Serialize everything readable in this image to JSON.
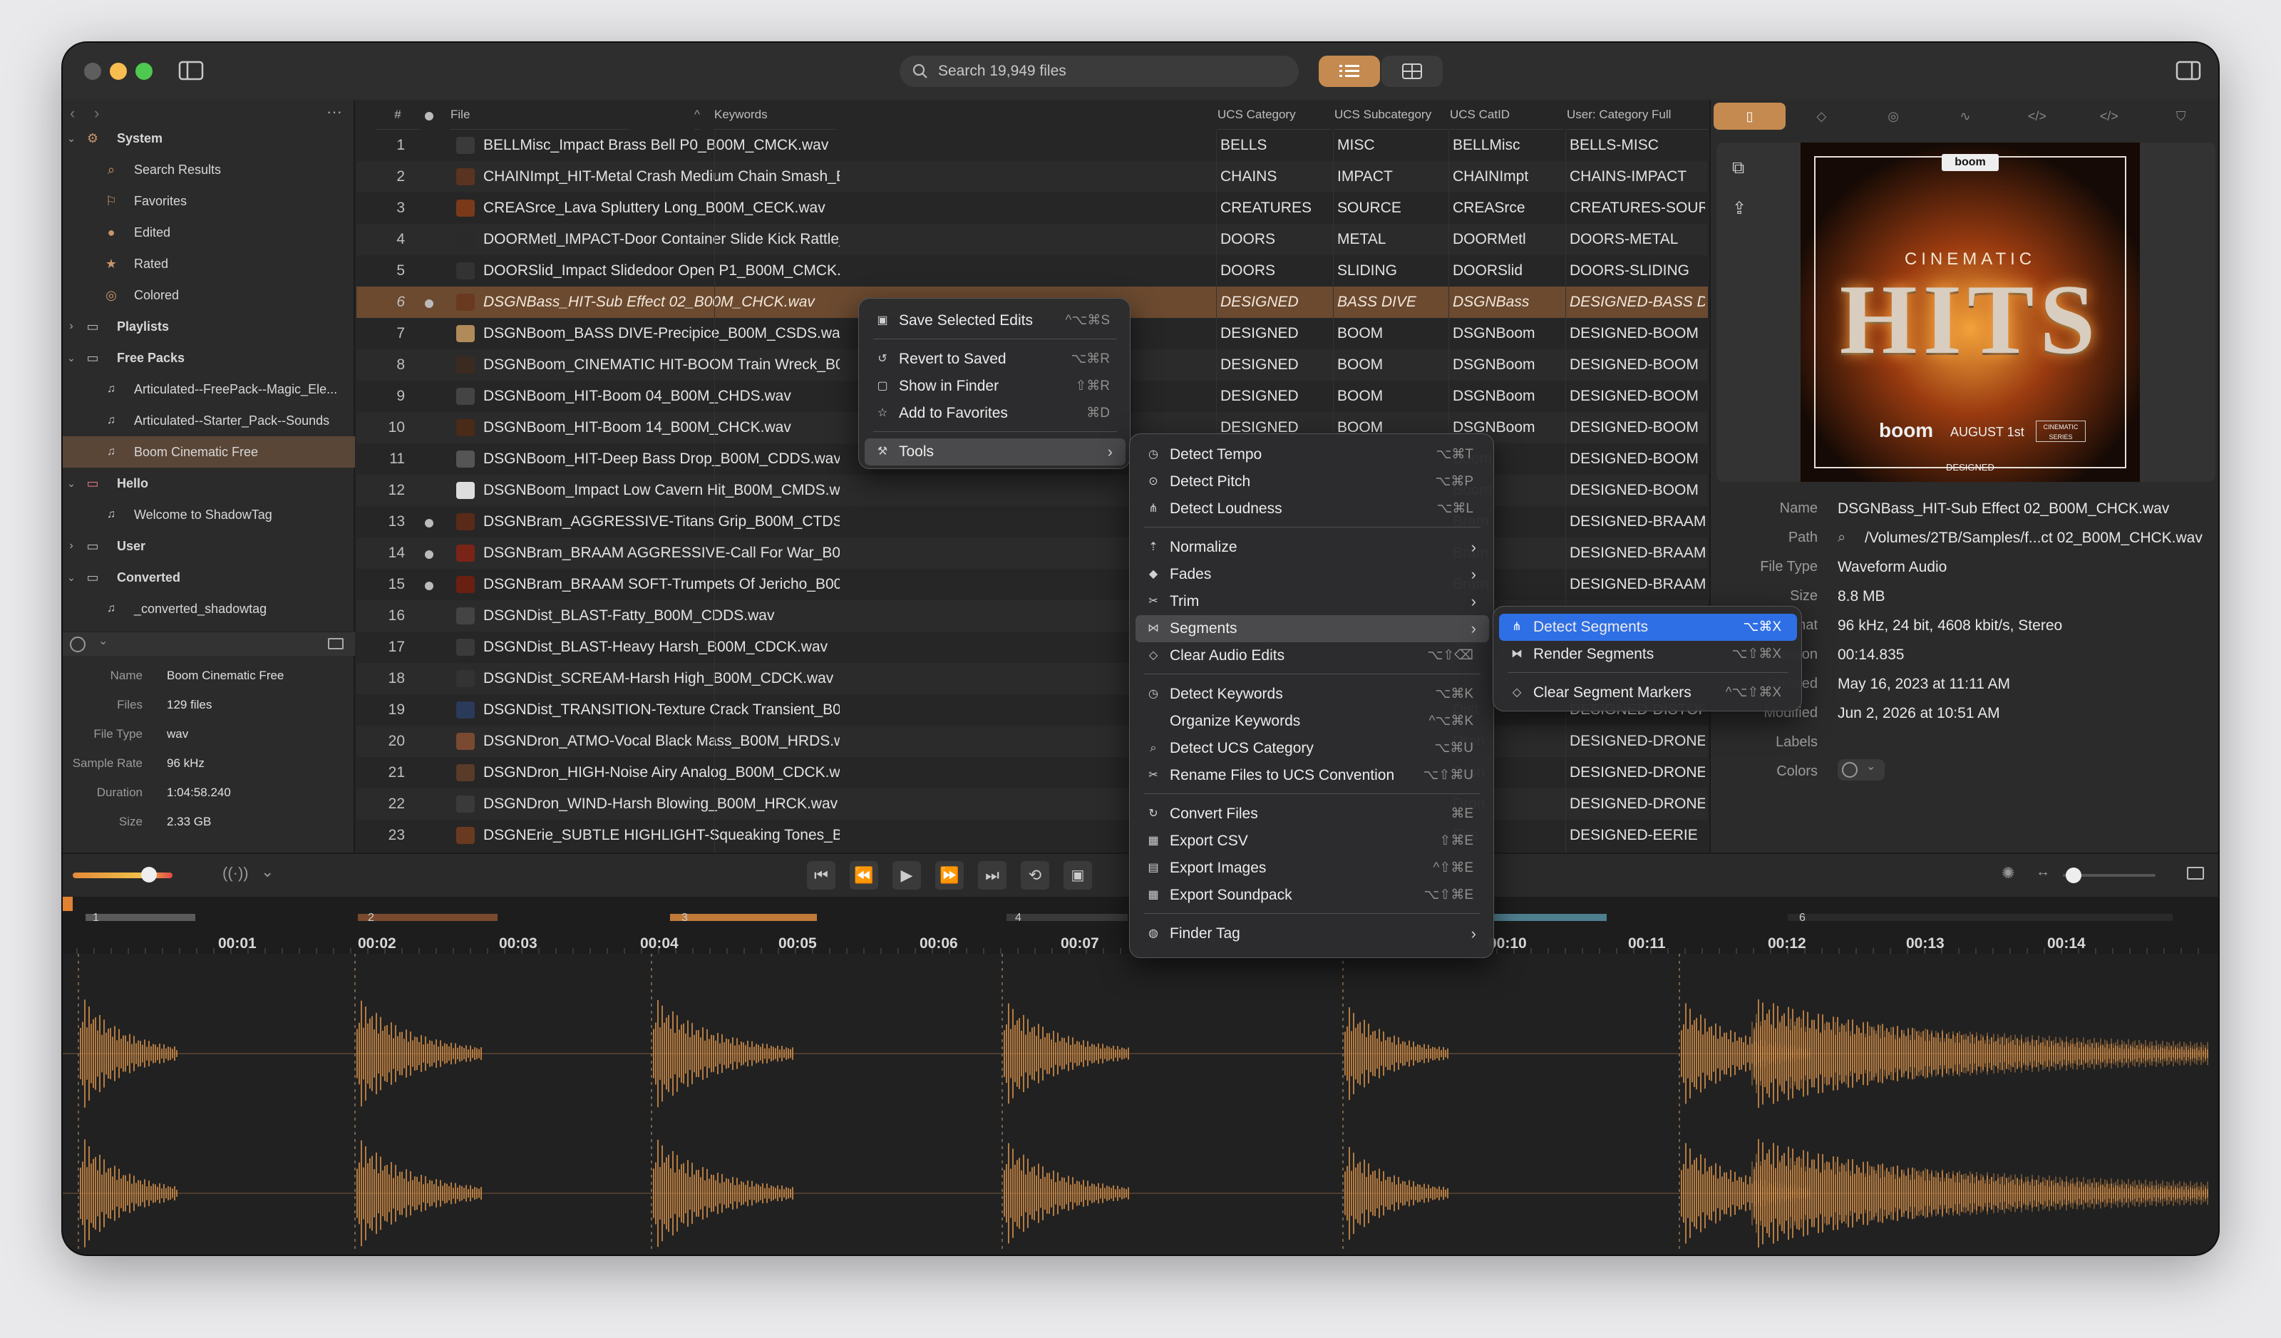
{
  "search": {
    "placeholder": "Search 19,949 files"
  },
  "sidebar": {
    "system": "System",
    "system_items": [
      "Search Results",
      "Favorites",
      "Edited",
      "Rated",
      "Colored"
    ],
    "playlists": "Playlists",
    "free_packs": "Free Packs",
    "free_packs_items": [
      "Articulated--FreePack--Magic_Ele...",
      "Articulated--Starter_Pack--Sounds",
      "Boom Cinematic Free"
    ],
    "hello": "Hello",
    "hello_items": [
      "Welcome to ShadowTag"
    ],
    "user": "User",
    "converted": "Converted",
    "converted_items": [
      "_converted_shadowtag"
    ]
  },
  "info": {
    "rows": [
      {
        "label": "Name",
        "value": "Boom Cinematic Free"
      },
      {
        "label": "Files",
        "value": "129 files"
      },
      {
        "label": "File Type",
        "value": "wav"
      },
      {
        "label": "Sample Rate",
        "value": "96 kHz"
      },
      {
        "label": "Duration",
        "value": "1:04:58.240"
      },
      {
        "label": "Size",
        "value": "2.33 GB"
      }
    ]
  },
  "table": {
    "headers": {
      "num": "#",
      "file": "File",
      "keywords": "Keywords",
      "category": "UCS Category",
      "subcategory": "UCS Subcategory",
      "catid": "UCS CatID",
      "user_cat": "User: Category Full"
    },
    "rows": [
      {
        "n": "1",
        "file": "BELLMisc_Impact Brass Bell P0_B00M_CMCK.wav",
        "cat": "BELLS",
        "sub": "MISC",
        "id": "BELLMisc",
        "full": "BELLS-MISC"
      },
      {
        "n": "2",
        "file": "CHAINImpt_HIT-Metal Crash Medium Chain Smash_B00M_CHCK.wav",
        "cat": "CHAINS",
        "sub": "IMPACT",
        "id": "CHAINImpt",
        "full": "CHAINS-IMPACT"
      },
      {
        "n": "3",
        "file": "CREASrce_Lava Spluttery Long_B00M_CECK.wav",
        "cat": "CREATURES",
        "sub": "SOURCE",
        "id": "CREASrce",
        "full": "CREATURES-SOURC"
      },
      {
        "n": "4",
        "file": "DOORMetl_IMPACT-Door Container Slide Kick Rattle_B00M_CTCK.wav",
        "cat": "DOORS",
        "sub": "METAL",
        "id": "DOORMetl",
        "full": "DOORS-METAL"
      },
      {
        "n": "5",
        "file": "DOORSlid_Impact Slidedoor Open P1_B00M_CMCK.wav",
        "cat": "DOORS",
        "sub": "SLIDING",
        "id": "DOORSlid",
        "full": "DOORS-SLIDING"
      },
      {
        "n": "6",
        "file": "DSGNBass_HIT-Sub Effect 02_B00M_CHCK.wav",
        "cat": "DESIGNED",
        "sub": "BASS DIVE",
        "id": "DSGNBass",
        "full": "DESIGNED-BASS D"
      },
      {
        "n": "7",
        "file": "DSGNBoom_BASS DIVE-Precipice_B00M_CSDS.wav",
        "cat": "DESIGNED",
        "sub": "BOOM",
        "id": "DSGNBoom",
        "full": "DESIGNED-BOOM"
      },
      {
        "n": "8",
        "file": "DSGNBoom_CINEMATIC HIT-BOOM Train Wreck_B00",
        "cat": "DESIGNED",
        "sub": "BOOM",
        "id": "DSGNBoom",
        "full": "DESIGNED-BOOM"
      },
      {
        "n": "9",
        "file": "DSGNBoom_HIT-Boom 04_B00M_CHDS.wav",
        "cat": "DESIGNED",
        "sub": "BOOM",
        "id": "DSGNBoom",
        "full": "DESIGNED-BOOM"
      },
      {
        "n": "10",
        "file": "DSGNBoom_HIT-Boom 14_B00M_CHCK.wav",
        "cat": "DESIGNED",
        "sub": "BOOM",
        "id": "DSGNBoom",
        "full": "DESIGNED-BOOM"
      },
      {
        "n": "11",
        "file": "DSGNBoom_HIT-Deep Bass Drop_B00M_CDDS.wav",
        "cat": "",
        "sub": "",
        "id": "Boom",
        "full": "DESIGNED-BOOM"
      },
      {
        "n": "12",
        "file": "DSGNBoom_Impact Low Cavern Hit_B00M_CMDS.wav",
        "cat": "",
        "sub": "",
        "id": "Boom",
        "full": "DESIGNED-BOOM"
      },
      {
        "n": "13",
        "file": "DSGNBram_AGGRESSIVE-Titans Grip_B00M_CTDS.wav",
        "cat": "",
        "sub": "",
        "id": "Bram",
        "full": "DESIGNED-BRAAM"
      },
      {
        "n": "14",
        "file": "DSGNBram_BRAAM AGGRESSIVE-Call For War_B00M_CXDS_G.wav",
        "cat": "",
        "sub": "",
        "id": "Bram",
        "full": "DESIGNED-BRAAM"
      },
      {
        "n": "15",
        "file": "DSGNBram_BRAAM SOFT-Trumpets Of Jericho_B00M_CXDS_B.wav",
        "cat": "",
        "sub": "",
        "id": "Bram",
        "full": "DESIGNED-BRAAM"
      },
      {
        "n": "16",
        "file": "DSGNDist_BLAST-Fatty_B00M_CDDS.wav",
        "cat": "",
        "sub": "",
        "id": "",
        "full": ""
      },
      {
        "n": "17",
        "file": "DSGNDist_BLAST-Heavy Harsh_B00M_CDCK.wav",
        "cat": "",
        "sub": "",
        "id": "",
        "full": ""
      },
      {
        "n": "18",
        "file": "DSGNDist_SCREAM-Harsh High_B00M_CDCK.wav",
        "cat": "",
        "sub": "",
        "id": "",
        "full": ""
      },
      {
        "n": "19",
        "file": "DSGNDist_TRANSITION-Texture Crack Transient_B00M_CMCK.wav",
        "cat": "",
        "sub": "",
        "id": "Dist",
        "full": "DESIGNED-DISTOR"
      },
      {
        "n": "20",
        "file": "DSGNDron_ATMO-Vocal Black Mass_B00M_HRDS.wav",
        "cat": "",
        "sub": "",
        "id": "Dron",
        "full": "DESIGNED-DRONE"
      },
      {
        "n": "21",
        "file": "DSGNDron_HIGH-Noise Airy Analog_B00M_CDCK.wav",
        "cat": "",
        "sub": "",
        "id": "Dron",
        "full": "DESIGNED-DRONE"
      },
      {
        "n": "22",
        "file": "DSGNDron_WIND-Harsh Blowing_B00M_HRCK.wav",
        "cat": "",
        "sub": "",
        "id": "Dron",
        "full": "DESIGNED-DRONE"
      },
      {
        "n": "23",
        "file": "DSGNErie_SUBTLE HIGHLIGHT-Squeaking Tones_B00M_HRDS.wav",
        "cat": "",
        "sub": "",
        "id": "Erie",
        "full": "DESIGNED-EERIE"
      }
    ]
  },
  "right": {
    "art": {
      "logo": "boom",
      "sub": "CINEMATIC",
      "title": "HITS",
      "brand": "boom",
      "date": "AUGUST 1st",
      "badge": "CINEMATIC SERIES",
      "tag": "DESIGNED"
    },
    "details": [
      {
        "label": "Name",
        "value": "DSGNBass_HIT-Sub Effect 02_B00M_CHCK.wav"
      },
      {
        "label": "Path",
        "value": "/Volumes/2TB/Samples/f...ct 02_B00M_CHCK.wav"
      },
      {
        "label": "File Type",
        "value": "Waveform Audio"
      },
      {
        "label": "Size",
        "value": "8.8 MB"
      },
      {
        "label": "Format",
        "value": "96 kHz, 24 bit, 4608 kbit/s, Stereo"
      },
      {
        "label": "Duration",
        "value": "00:14.835"
      },
      {
        "label": "Created",
        "value": "May 16, 2023 at 11:11 AM"
      },
      {
        "label": "Modified",
        "value": "Jun 2, 2026 at 10:51 AM"
      },
      {
        "label": "Labels",
        "value": ""
      },
      {
        "label": "Colors",
        "value": ""
      }
    ]
  },
  "menu1": {
    "items": [
      {
        "label": "Save Selected Edits",
        "shortcut": "^⌥⌘S",
        "icon": "save-icon"
      },
      {
        "label": "Revert to Saved",
        "shortcut": "⌥⌘R",
        "icon": "revert-icon"
      },
      {
        "label": "Show in Finder",
        "shortcut": "⇧⌘R",
        "icon": "finder-icon"
      },
      {
        "label": "Add to Favorites",
        "shortcut": "⌘D",
        "icon": "star-icon"
      },
      {
        "label": "Tools",
        "shortcut": "",
        "icon": "wrench-icon"
      }
    ]
  },
  "menu2": {
    "items": [
      {
        "label": "Detect Tempo",
        "shortcut": "⌥⌘T"
      },
      {
        "label": "Detect Pitch",
        "shortcut": "⌥⌘P"
      },
      {
        "label": "Detect Loudness",
        "shortcut": "⌥⌘L"
      },
      {
        "label": "Normalize",
        "shortcut": ""
      },
      {
        "label": "Fades",
        "shortcut": ""
      },
      {
        "label": "Trim",
        "shortcut": ""
      },
      {
        "label": "Segments",
        "shortcut": ""
      },
      {
        "label": "Clear Audio Edits",
        "shortcut": "⌥⇧⌫"
      },
      {
        "label": "Detect Keywords",
        "shortcut": "⌥⌘K"
      },
      {
        "label": "Organize Keywords",
        "shortcut": "^⌥⌘K"
      },
      {
        "label": "Detect UCS Category",
        "shortcut": "⌥⌘U"
      },
      {
        "label": "Rename Files to UCS Convention",
        "shortcut": "⌥⇧⌘U"
      },
      {
        "label": "Convert Files",
        "shortcut": "⌘E"
      },
      {
        "label": "Export CSV",
        "shortcut": "⇧⌘E"
      },
      {
        "label": "Export Images",
        "shortcut": "^⇧⌘E"
      },
      {
        "label": "Export Soundpack",
        "shortcut": "⌥⇧⌘E"
      },
      {
        "label": "Finder Tag",
        "shortcut": ""
      }
    ]
  },
  "menu3": {
    "items": [
      {
        "label": "Detect Segments",
        "shortcut": "⌥⌘X"
      },
      {
        "label": "Render Segments",
        "shortcut": "⌥⇧⌘X"
      },
      {
        "label": "Clear Segment Markers",
        "shortcut": "^⌥⇧⌘X"
      }
    ]
  },
  "waveform": {
    "time_labels": [
      "00:01",
      "00:02",
      "00:03",
      "00:04",
      "00:05",
      "00:06",
      "00:07",
      "00:10",
      "00:11",
      "00:12",
      "00:13",
      "00:14"
    ],
    "segment_labels": [
      "1",
      "2",
      "3",
      "4",
      "6"
    ],
    "accent": "#d9924a"
  },
  "colors": {
    "accent": "#d9924a",
    "selection": "#6b4a30",
    "menu_highlight": "#2f6fe6"
  }
}
